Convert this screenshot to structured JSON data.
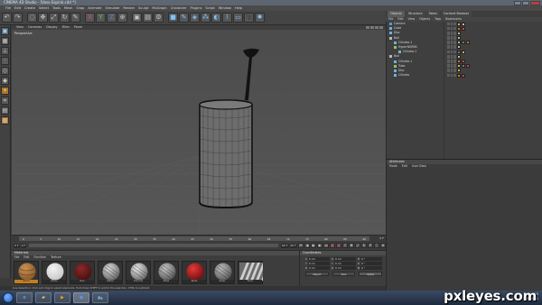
{
  "window": {
    "title": "CINEMA 4D Studio - [Vaso Espiral.c4d *]"
  },
  "menubar": [
    "File",
    "Edit",
    "Create",
    "Select",
    "Tools",
    "Mesh",
    "Snap",
    "Animate",
    "Simulate",
    "Render",
    "Sculpt",
    "MoGraph",
    "Character",
    "Plugins",
    "Script",
    "Window",
    "Help"
  ],
  "toolbar_icons": [
    "undo-icon",
    "redo-icon",
    "live-select-icon",
    "move-icon",
    "scale-icon",
    "rotate-icon",
    "last-tool-icon",
    "x-axis-icon",
    "y-axis-icon",
    "z-axis-icon",
    "coordinate-system-icon",
    "render-view-icon",
    "render-picture-viewer-icon",
    "render-settings-icon",
    "cube-icon",
    "pen-spline-icon",
    "subdivision-surface-icon",
    "array-icon",
    "boole-icon",
    "deformer-icon",
    "floor-icon",
    "camera-icon",
    "light-icon"
  ],
  "viewport": {
    "menu": [
      "View",
      "Cameras",
      "Display",
      "Filter",
      "Panel"
    ],
    "label": "Perspective"
  },
  "timeline": {
    "ticks": [
      "0",
      "5",
      "10",
      "15",
      "20",
      "25",
      "30",
      "35",
      "40",
      "45",
      "50",
      "55",
      "60",
      "65",
      "70",
      "75",
      "80",
      "85",
      "90"
    ],
    "end": "0 F"
  },
  "playback": {
    "start": "0 F",
    "current": "0 F",
    "end": "90 F",
    "max": "90 F"
  },
  "materials": {
    "title": "Materials",
    "menu": [
      "File",
      "Edit",
      "Function",
      "Texture"
    ],
    "swatches": [
      {
        "name": "Wood",
        "kind": "wood",
        "selected": true
      },
      {
        "name": "White",
        "kind": "white",
        "selected": false
      },
      {
        "name": "Red",
        "kind": "dark-red",
        "selected": false
      },
      {
        "name": "Metal",
        "kind": "metal-plate",
        "selected": false
      },
      {
        "name": "Chrome",
        "kind": "silver",
        "selected": false
      },
      {
        "name": "Steel",
        "kind": "steel",
        "selected": false
      },
      {
        "name": "Red2",
        "kind": "red",
        "selected": false
      },
      {
        "name": "Glass",
        "kind": "glass",
        "selected": false
      },
      {
        "name": "Floor",
        "kind": "stripes",
        "selected": false
      }
    ]
  },
  "coordinates": {
    "title": "Coordinates",
    "rows": [
      {
        "a": "X",
        "av": "0 cm",
        "b": "X",
        "bv": "0 cm",
        "c": "H",
        "cv": "0 °"
      },
      {
        "a": "Y",
        "av": "0 cm",
        "b": "Y",
        "bv": "0 cm",
        "c": "P",
        "cv": "0 °"
      },
      {
        "a": "Z",
        "av": "0 cm",
        "b": "Z",
        "bv": "0 cm",
        "c": "B",
        "cv": "0 °"
      }
    ],
    "mode": "Object",
    "size": "Size",
    "apply": "Apply"
  },
  "status": "Live Selection: Click and drag to select elements. Hold down SHIFT to add to the selection, CTRL to subtract.",
  "right_tabs": [
    "Objects",
    "Structure",
    "Takes",
    "Content Browser"
  ],
  "object_menu": [
    "File",
    "Edit",
    "View",
    "Objects",
    "Tags",
    "Bookmarks"
  ],
  "objects": [
    {
      "name": "Camera",
      "indent": 0,
      "icon": "#5a9ad6"
    },
    {
      "name": "Cube",
      "indent": 0,
      "icon": "#6fb1e0"
    },
    {
      "name": "Disc",
      "indent": 0,
      "icon": "#6fb1e0"
    },
    {
      "name": "Null",
      "indent": 0,
      "icon": "#b9b9b9"
    },
    {
      "name": "Cilindro.1",
      "indent": 1,
      "icon": "#6fb1e0"
    },
    {
      "name": "HyperNURBS",
      "indent": 1,
      "icon": "#8cc56a"
    },
    {
      "name": "Cilindro.1",
      "indent": 2,
      "icon": "#6fb1e0"
    },
    {
      "name": "Null",
      "indent": 0,
      "icon": "#b9b9b9"
    },
    {
      "name": "Cilindro.1",
      "indent": 1,
      "icon": "#6fb1e0"
    },
    {
      "name": "Tubo",
      "indent": 1,
      "icon": "#8cc56a"
    },
    {
      "name": "Disc",
      "indent": 1,
      "icon": "#6fb1e0"
    },
    {
      "name": "Cilindro",
      "indent": 1,
      "icon": "#6fb1e0"
    }
  ],
  "attributes": {
    "title": "Attributes",
    "menu": [
      "Mode",
      "Edit",
      "User Data"
    ]
  },
  "taskbar": {
    "apps": [
      "ie-icon",
      "folder-icon",
      "media-player-icon",
      "cinema4d-icon",
      "photoshop-icon"
    ],
    "time": "14:25",
    "date": "07/06/2011"
  },
  "watermark": "pxleyes.com"
}
